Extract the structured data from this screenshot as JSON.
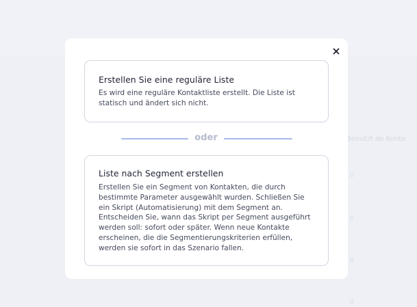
{
  "background": {
    "label_fragment": "Benutzt de Konto",
    "marks": [
      "0",
      "0",
      "0",
      "0"
    ]
  },
  "modal": {
    "close_icon": "close-icon",
    "option_regular": {
      "title": "Erstellen Sie eine reguläre Liste",
      "description": "Es wird eine reguläre Kontaktliste erstellt. Die Liste ist statisch und ändert sich nicht."
    },
    "divider_text": "oder",
    "option_segment": {
      "title": "Liste nach Segment erstellen",
      "description_lines": [
        "Erstellen Sie ein Segment von Kontakten, die durch",
        "bestimmte Parameter ausgewählt wurden. Schließen Sie",
        "ein Skript (Automatisierung) mit dem Segment an.",
        "Entscheiden Sie, wann das Skript per Segment ausgeführt",
        "werden soll: sofort oder später. Wenn neue Kontakte",
        "erscheinen, die die Segmentierungskriterien erfüllen,",
        "werden sie sofort in das Szenario fallen."
      ]
    }
  },
  "colors": {
    "backdrop": "#eef0f6",
    "card_border": "#d3d6e2",
    "divider_line": "#a9b8ec",
    "divider_text": "#b5bccd"
  }
}
